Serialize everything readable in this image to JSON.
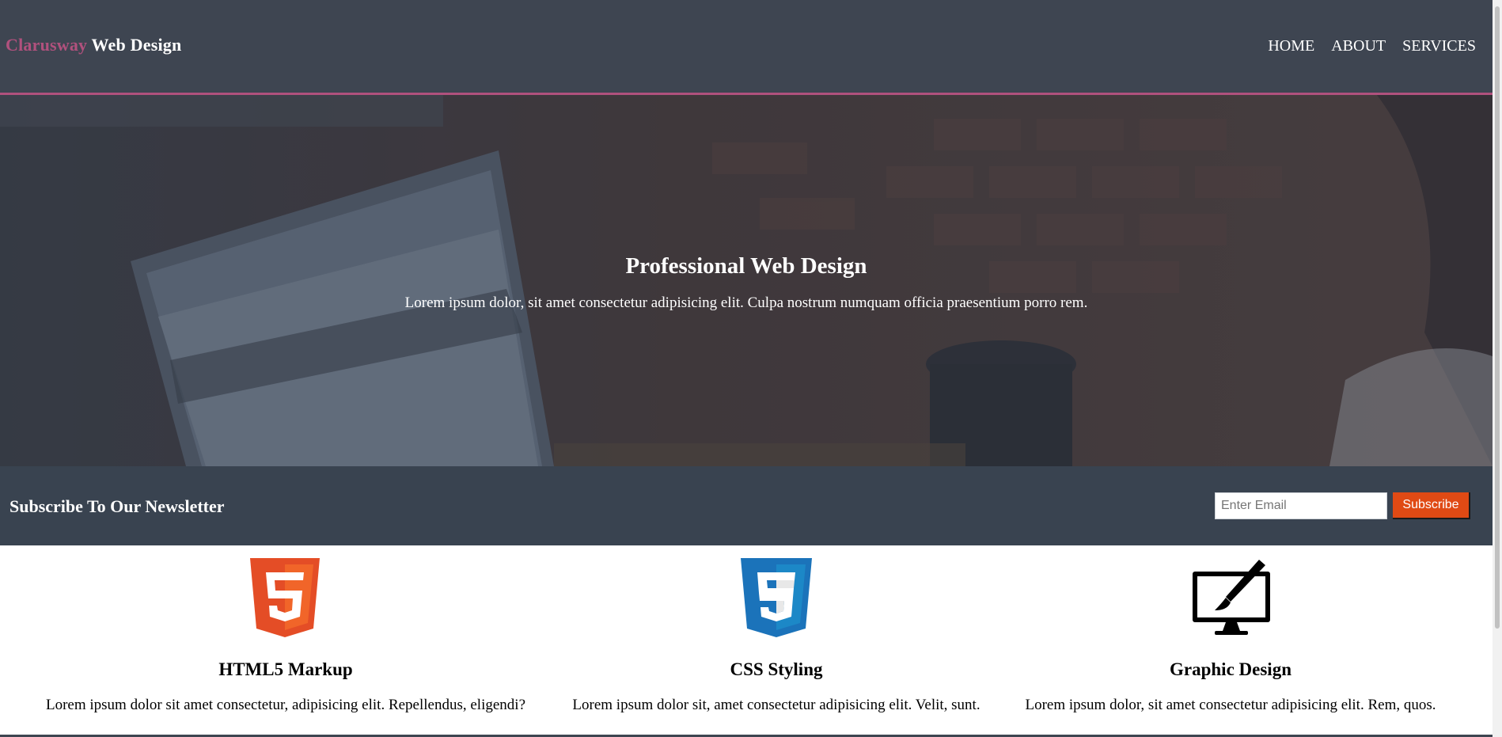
{
  "header": {
    "brand_accent": "Clarusway",
    "brand_rest": " Web Design",
    "nav": [
      "HOME",
      "ABOUT",
      "SERVICES"
    ]
  },
  "hero": {
    "title": "Professional Web Design",
    "subtitle": "Lorem ipsum dolor, sit amet consectetur adipisicing elit. Culpa nostrum numquam officia praesentium porro rem."
  },
  "newsletter": {
    "heading": "Subscribe To Our Newsletter",
    "email_placeholder": "Enter Email",
    "subscribe_label": "Subscribe"
  },
  "features": [
    {
      "icon": "html5-icon",
      "title": "HTML5 Markup",
      "text": "Lorem ipsum dolor sit amet consectetur, adipisicing elit. Repellendus, eligendi?"
    },
    {
      "icon": "css3-icon",
      "title": "CSS Styling",
      "text": "Lorem ipsum dolor sit, amet consectetur adipisicing elit. Velit, sunt."
    },
    {
      "icon": "graphic-design-icon",
      "title": "Graphic Design",
      "text": "Lorem ipsum dolor, sit amet consectetur adipisicing elit. Rem, quos."
    }
  ],
  "colors": {
    "header_bg": "#3e4551",
    "accent": "#b0517d",
    "newsletter_bg": "#394350",
    "button": "#e04a14"
  }
}
